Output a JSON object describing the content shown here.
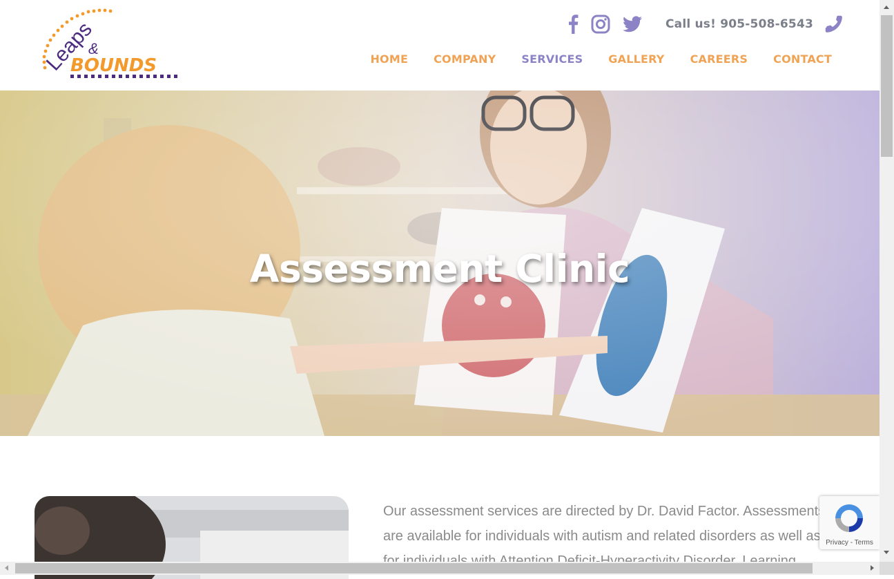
{
  "logo": {
    "line1": "Leaps",
    "amp": "&",
    "line2": "BOUNDS"
  },
  "topbar": {
    "social": [
      {
        "name": "facebook-icon"
      },
      {
        "name": "instagram-icon"
      },
      {
        "name": "twitter-icon"
      }
    ],
    "call_text": "Call us! 905-508-6543",
    "phone_icon": "phone-icon"
  },
  "nav": {
    "items": [
      {
        "label": "HOME",
        "active": false
      },
      {
        "label": "COMPANY",
        "active": false
      },
      {
        "label": "SERVICES",
        "active": true
      },
      {
        "label": "GALLERY",
        "active": false
      },
      {
        "label": "CAREERS",
        "active": false
      },
      {
        "label": "CONTACT",
        "active": false
      }
    ]
  },
  "hero": {
    "title": "Assessment Clinic"
  },
  "content": {
    "intro": "Our assessment services are directed by Dr. David Factor. Assessments are available for individuals with autism and related disorders as well as for individuals with Attention Deficit-Hyperactivity Disorder, Learning"
  },
  "recaptcha": {
    "privacy": "Privacy",
    "sep": " - ",
    "terms": "Terms"
  },
  "colors": {
    "accent_orange": "#f0a354",
    "accent_purple": "#8b83c6",
    "text_gray": "#8a8a8a"
  }
}
